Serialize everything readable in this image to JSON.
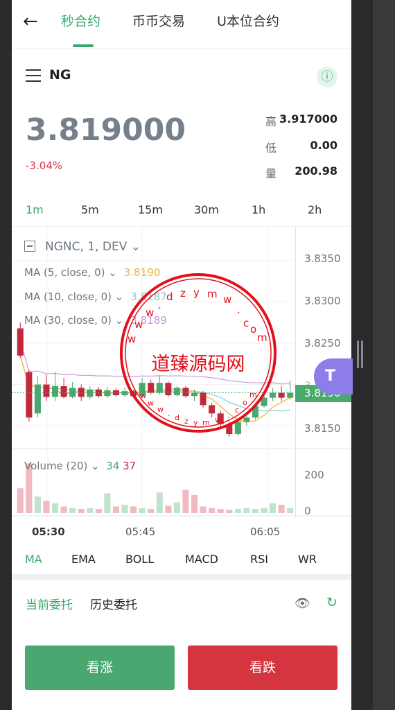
{
  "header": {
    "back_icon": "arrow-left-icon",
    "tabs": [
      "秒合约",
      "币币交易",
      "U本位合约"
    ]
  },
  "ticker": {
    "symbol": "NG",
    "price": "3.819000",
    "change": "-3.04%",
    "high_label": "高",
    "high": "3.917000",
    "low_label": "低",
    "low": "0.00",
    "volume_label": "量",
    "volume": "200.98"
  },
  "intervals": [
    "1m",
    "5m",
    "15m",
    "30m",
    "1h",
    "2h"
  ],
  "chart": {
    "title": "NGNC, 1, DEV",
    "ma5_label": "MA (5, close, 0)",
    "ma5_value": "3.8190",
    "ma10_label": "MA (10, close, 0)",
    "ma10_value": "3.8187",
    "ma30_label": "MA (30, close, 0)",
    "ma30_value": "3.8189",
    "price_ticks": [
      "3.8350",
      "3.8300",
      "3.8250",
      "3.8200",
      "3.8150"
    ],
    "current_price_tag": "3.8190",
    "volume_label": "Volume (20)",
    "volume_up": "34",
    "volume_down": "37",
    "volume_ticks": [
      "200",
      "0"
    ],
    "time_ticks": [
      "05:30",
      "05:45",
      "06:05"
    ]
  },
  "indicators": [
    "MA",
    "EMA",
    "BOLL",
    "MACD",
    "RSI",
    "WR"
  ],
  "orders": {
    "current": "当前委托",
    "history": "历史委托"
  },
  "buttons": {
    "up": "看涨",
    "down": "看跌"
  },
  "watermark": {
    "title": "道臻源码网",
    "url": "www.dzymw.com"
  },
  "chart_data": {
    "type": "candlestick",
    "y_range": [
      3.813,
      3.8375
    ],
    "candles": [
      {
        "o": 3.8268,
        "h": 3.8275,
        "c": 3.8235,
        "l": 3.8232,
        "dir": "down"
      },
      {
        "o": 3.8215,
        "h": 3.8218,
        "c": 3.816,
        "l": 3.8155,
        "dir": "down"
      },
      {
        "o": 3.8165,
        "h": 3.821,
        "c": 3.82,
        "l": 3.816,
        "dir": "up"
      },
      {
        "o": 3.82,
        "h": 3.8212,
        "c": 3.8185,
        "l": 3.818,
        "dir": "down"
      },
      {
        "o": 3.8185,
        "h": 3.8215,
        "c": 3.8198,
        "l": 3.818,
        "dir": "up"
      },
      {
        "o": 3.8198,
        "h": 3.8208,
        "c": 3.8185,
        "l": 3.8183,
        "dir": "down"
      },
      {
        "o": 3.8185,
        "h": 3.8203,
        "c": 3.8196,
        "l": 3.8183,
        "dir": "up"
      },
      {
        "o": 3.8196,
        "h": 3.82,
        "c": 3.8185,
        "l": 3.818,
        "dir": "down"
      },
      {
        "o": 3.8185,
        "h": 3.8198,
        "c": 3.8194,
        "l": 3.8182,
        "dir": "up"
      },
      {
        "o": 3.8194,
        "h": 3.8197,
        "c": 3.8186,
        "l": 3.8184,
        "dir": "down"
      },
      {
        "o": 3.8186,
        "h": 3.8197,
        "c": 3.8193,
        "l": 3.8184,
        "dir": "up"
      },
      {
        "o": 3.8193,
        "h": 3.8196,
        "c": 3.8187,
        "l": 3.8185,
        "dir": "down"
      },
      {
        "o": 3.8187,
        "h": 3.8196,
        "c": 3.8192,
        "l": 3.8185,
        "dir": "up"
      },
      {
        "o": 3.8192,
        "h": 3.8194,
        "c": 3.8186,
        "l": 3.8184,
        "dir": "down"
      },
      {
        "o": 3.8186,
        "h": 3.8208,
        "c": 3.8202,
        "l": 3.8184,
        "dir": "up"
      },
      {
        "o": 3.8202,
        "h": 3.8206,
        "c": 3.819,
        "l": 3.8188,
        "dir": "down"
      },
      {
        "o": 3.819,
        "h": 3.821,
        "c": 3.8202,
        "l": 3.8188,
        "dir": "up"
      },
      {
        "o": 3.8202,
        "h": 3.8204,
        "c": 3.8187,
        "l": 3.8185,
        "dir": "down"
      },
      {
        "o": 3.8187,
        "h": 3.8198,
        "c": 3.8196,
        "l": 3.8185,
        "dir": "up"
      },
      {
        "o": 3.8196,
        "h": 3.8198,
        "c": 3.8186,
        "l": 3.8184,
        "dir": "down"
      },
      {
        "o": 3.8186,
        "h": 3.8194,
        "c": 3.819,
        "l": 3.818,
        "dir": "up"
      },
      {
        "o": 3.819,
        "h": 3.8192,
        "c": 3.8175,
        "l": 3.8172,
        "dir": "down"
      },
      {
        "o": 3.8175,
        "h": 3.8178,
        "c": 3.8165,
        "l": 3.816,
        "dir": "down"
      },
      {
        "o": 3.8165,
        "h": 3.8168,
        "c": 3.8152,
        "l": 3.8148,
        "dir": "down"
      },
      {
        "o": 3.8152,
        "h": 3.8155,
        "c": 3.814,
        "l": 3.8137,
        "dir": "down"
      },
      {
        "o": 3.814,
        "h": 3.8158,
        "c": 3.8155,
        "l": 3.8138,
        "dir": "up"
      },
      {
        "o": 3.8155,
        "h": 3.8162,
        "c": 3.816,
        "l": 3.815,
        "dir": "up"
      },
      {
        "o": 3.816,
        "h": 3.8178,
        "c": 3.8174,
        "l": 3.8158,
        "dir": "up"
      },
      {
        "o": 3.8174,
        "h": 3.819,
        "c": 3.8184,
        "l": 3.8172,
        "dir": "up"
      },
      {
        "o": 3.8184,
        "h": 3.8196,
        "c": 3.819,
        "l": 3.818,
        "dir": "up"
      },
      {
        "o": 3.819,
        "h": 3.8198,
        "c": 3.8184,
        "l": 3.818,
        "dir": "down"
      },
      {
        "o": 3.8184,
        "h": 3.8205,
        "c": 3.819,
        "l": 3.8182,
        "dir": "up"
      }
    ],
    "volumes": [
      {
        "v": 0.3,
        "dir": "down"
      },
      {
        "v": 0.6,
        "dir": "down"
      },
      {
        "v": 0.2,
        "dir": "up"
      },
      {
        "v": 0.15,
        "dir": "down"
      },
      {
        "v": 0.12,
        "dir": "up"
      },
      {
        "v": 0.08,
        "dir": "down"
      },
      {
        "v": 0.06,
        "dir": "up"
      },
      {
        "v": 0.05,
        "dir": "down"
      },
      {
        "v": 0.06,
        "dir": "up"
      },
      {
        "v": 0.05,
        "dir": "down"
      },
      {
        "v": 0.24,
        "dir": "up"
      },
      {
        "v": 0.08,
        "dir": "down"
      },
      {
        "v": 0.1,
        "dir": "up"
      },
      {
        "v": 0.08,
        "dir": "down"
      },
      {
        "v": 0.06,
        "dir": "up"
      },
      {
        "v": 0.05,
        "dir": "down"
      },
      {
        "v": 0.25,
        "dir": "up"
      },
      {
        "v": 0.09,
        "dir": "down"
      },
      {
        "v": 0.13,
        "dir": "up"
      },
      {
        "v": 0.28,
        "dir": "down"
      },
      {
        "v": 0.22,
        "dir": "down"
      },
      {
        "v": 0.08,
        "dir": "down"
      },
      {
        "v": 0.06,
        "dir": "down"
      },
      {
        "v": 0.05,
        "dir": "down"
      },
      {
        "v": 0.04,
        "dir": "down"
      },
      {
        "v": 0.05,
        "dir": "up"
      },
      {
        "v": 0.06,
        "dir": "up"
      },
      {
        "v": 0.05,
        "dir": "up"
      },
      {
        "v": 0.06,
        "dir": "up"
      },
      {
        "v": 0.12,
        "dir": "up"
      },
      {
        "v": 0.1,
        "dir": "down"
      },
      {
        "v": 0.06,
        "dir": "up"
      }
    ],
    "volume_range": [
      0,
      220
    ],
    "colors": {
      "up": "#4aa770",
      "down": "#c4283c",
      "ma5": "#f2b630",
      "ma10": "#8cd4d6",
      "ma30": "#c9a6dc"
    }
  },
  "float_button": "T"
}
